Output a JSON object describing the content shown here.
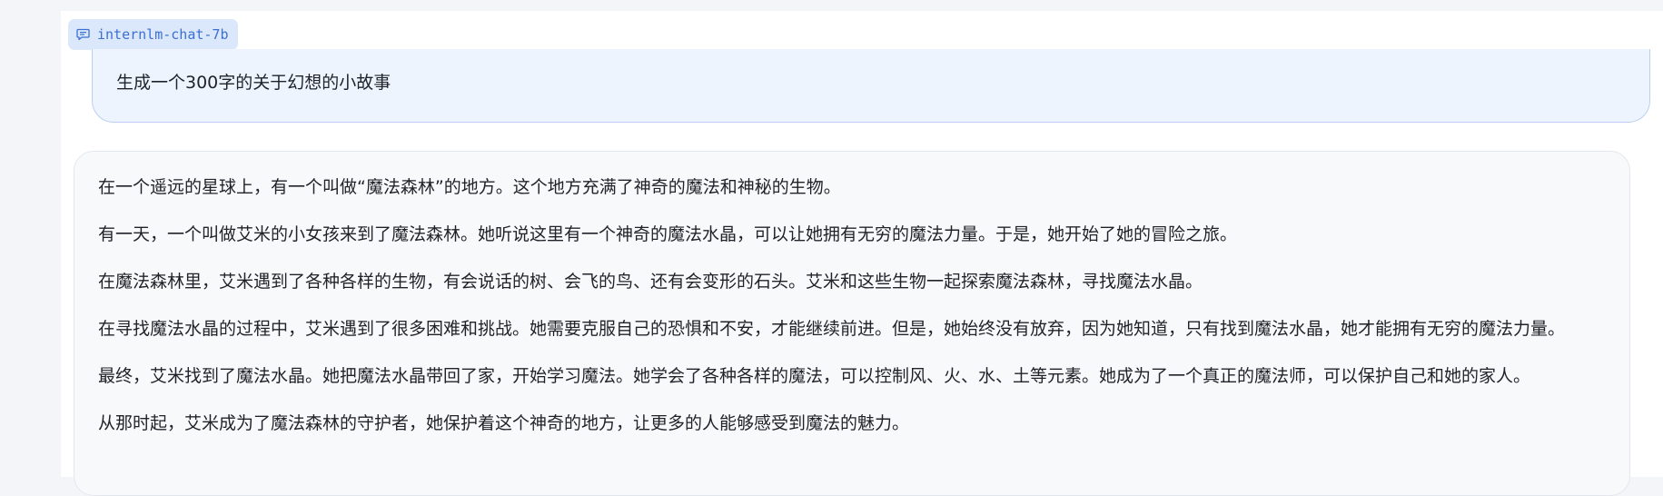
{
  "model": {
    "name": "internlm-chat-7b",
    "icon": "chat-bubble-icon",
    "accent": "#3b6fd3"
  },
  "user_message": {
    "text": "生成一个300字的关于幻想的小故事"
  },
  "assistant_message": {
    "paragraphs": [
      "在一个遥远的星球上，有一个叫做“魔法森林”的地方。这个地方充满了神奇的魔法和神秘的生物。",
      "有一天，一个叫做艾米的小女孩来到了魔法森林。她听说这里有一个神奇的魔法水晶，可以让她拥有无穷的魔法力量。于是，她开始了她的冒险之旅。",
      "在魔法森林里，艾米遇到了各种各样的生物，有会说话的树、会飞的鸟、还有会变形的石头。艾米和这些生物一起探索魔法森林，寻找魔法水晶。",
      "在寻找魔法水晶的过程中，艾米遇到了很多困难和挑战。她需要克服自己的恐惧和不安，才能继续前进。但是，她始终没有放弃，因为她知道，只有找到魔法水晶，她才能拥有无穷的魔法力量。",
      "最终，艾米找到了魔法水晶。她把魔法水晶带回了家，开始学习魔法。她学会了各种各样的魔法，可以控制风、火、水、土等元素。她成为了一个真正的魔法师，可以保护自己和她的家人。",
      "从那时起，艾米成为了魔法森林的守护者，她保护着这个神奇的地方，让更多的人能够感受到魔法的魅力。"
    ]
  }
}
